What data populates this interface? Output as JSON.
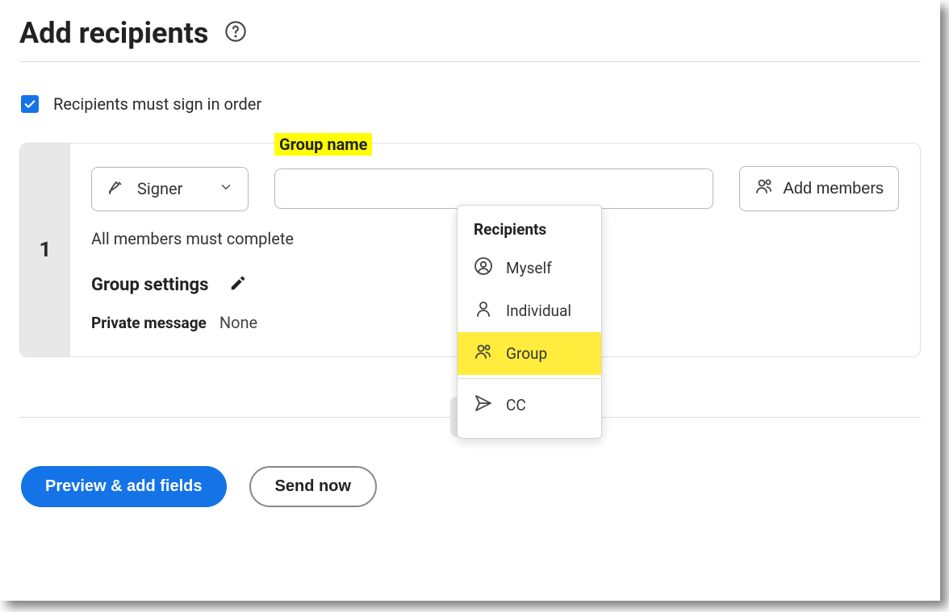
{
  "header": {
    "title": "Add recipients"
  },
  "sign_in_order": {
    "checked": true,
    "label": "Recipients must sign in order"
  },
  "recipient": {
    "order": "1",
    "role": "Signer",
    "group_name_label": "Group name",
    "group_name_value": "",
    "add_members_label": "Add members",
    "must_complete": "All members must complete",
    "group_settings_label": "Group settings",
    "private_message_label": "Private message",
    "private_message_value": "None"
  },
  "popover": {
    "heading": "Recipients",
    "items": [
      {
        "label": "Myself",
        "icon": "myself-icon",
        "highlight": false
      },
      {
        "label": "Individual",
        "icon": "individual-icon",
        "highlight": false
      },
      {
        "label": "Group",
        "icon": "group-icon",
        "highlight": true
      }
    ],
    "cc_label": "CC"
  },
  "footer": {
    "preview_label": "Preview & add fields",
    "send_label": "Send now"
  }
}
